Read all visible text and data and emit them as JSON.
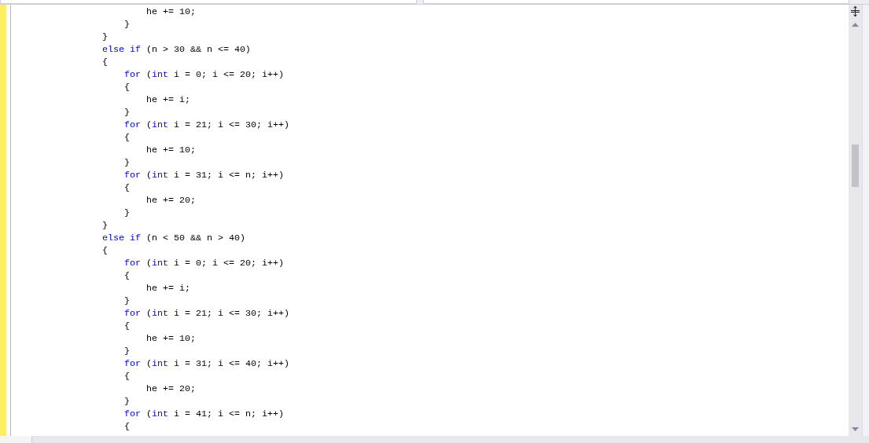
{
  "editor": {
    "lines": [
      {
        "children": [
          {
            "children": [
              {
                "tokens": [
                  {
                    "kind": "plain",
                    "text": "he += 10;"
                  }
                ]
              }
            ]
          },
          {
            "tokens": [
              {
                "kind": "plain",
                "text": "}"
              }
            ]
          }
        ]
      },
      {
        "tokens": [
          {
            "kind": "plain",
            "text": "}"
          }
        ]
      },
      {
        "tokens": [
          {
            "kind": "keyword",
            "text": "else if"
          },
          {
            "kind": "plain",
            "text": " (n > 30 && n <= 40)"
          }
        ]
      },
      {
        "tokens": [
          {
            "kind": "plain",
            "text": "{"
          }
        ],
        "children": [
          {
            "tokens": [
              {
                "kind": "keyword",
                "text": "for"
              },
              {
                "kind": "plain",
                "text": " ("
              },
              {
                "kind": "keyword",
                "text": "int"
              },
              {
                "kind": "plain",
                "text": " i = 0; i <= 20; i++)"
              }
            ]
          },
          {
            "tokens": [
              {
                "kind": "plain",
                "text": "{"
              }
            ],
            "children": [
              {
                "tokens": [
                  {
                    "kind": "plain",
                    "text": "he += i;"
                  }
                ]
              }
            ]
          },
          {
            "tokens": [
              {
                "kind": "plain",
                "text": "}"
              }
            ]
          },
          {
            "tokens": [
              {
                "kind": "keyword",
                "text": "for"
              },
              {
                "kind": "plain",
                "text": " ("
              },
              {
                "kind": "keyword",
                "text": "int"
              },
              {
                "kind": "plain",
                "text": " i = 21; i <= 30; i++)"
              }
            ]
          },
          {
            "tokens": [
              {
                "kind": "plain",
                "text": "{"
              }
            ],
            "children": [
              {
                "tokens": [
                  {
                    "kind": "plain",
                    "text": "he += 10;"
                  }
                ]
              }
            ]
          },
          {
            "tokens": [
              {
                "kind": "plain",
                "text": "}"
              }
            ]
          },
          {
            "tokens": [
              {
                "kind": "keyword",
                "text": "for"
              },
              {
                "kind": "plain",
                "text": " ("
              },
              {
                "kind": "keyword",
                "text": "int"
              },
              {
                "kind": "plain",
                "text": " i = 31; i <= n; i++)"
              }
            ]
          },
          {
            "tokens": [
              {
                "kind": "plain",
                "text": "{"
              }
            ],
            "children": [
              {
                "tokens": [
                  {
                    "kind": "plain",
                    "text": "he += 20;"
                  }
                ]
              }
            ]
          },
          {
            "tokens": [
              {
                "kind": "plain",
                "text": "}"
              }
            ]
          }
        ]
      },
      {
        "tokens": [
          {
            "kind": "plain",
            "text": "}"
          }
        ]
      },
      {
        "tokens": [
          {
            "kind": "keyword",
            "text": "else if"
          },
          {
            "kind": "plain",
            "text": " (n < 50 && n > 40)"
          }
        ]
      },
      {
        "tokens": [
          {
            "kind": "plain",
            "text": "{"
          }
        ],
        "children": [
          {
            "tokens": [
              {
                "kind": "keyword",
                "text": "for"
              },
              {
                "kind": "plain",
                "text": " ("
              },
              {
                "kind": "keyword",
                "text": "int"
              },
              {
                "kind": "plain",
                "text": " i = 0; i <= 20; i++)"
              }
            ]
          },
          {
            "tokens": [
              {
                "kind": "plain",
                "text": "{"
              }
            ],
            "children": [
              {
                "tokens": [
                  {
                    "kind": "plain",
                    "text": "he += i;"
                  }
                ]
              }
            ]
          },
          {
            "tokens": [
              {
                "kind": "plain",
                "text": "}"
              }
            ]
          },
          {
            "tokens": [
              {
                "kind": "keyword",
                "text": "for"
              },
              {
                "kind": "plain",
                "text": " ("
              },
              {
                "kind": "keyword",
                "text": "int"
              },
              {
                "kind": "plain",
                "text": " i = 21; i <= 30; i++)"
              }
            ]
          },
          {
            "tokens": [
              {
                "kind": "plain",
                "text": "{"
              }
            ],
            "children": [
              {
                "tokens": [
                  {
                    "kind": "plain",
                    "text": "he += 10;"
                  }
                ]
              }
            ]
          },
          {
            "tokens": [
              {
                "kind": "plain",
                "text": "}"
              }
            ]
          },
          {
            "tokens": [
              {
                "kind": "keyword",
                "text": "for"
              },
              {
                "kind": "plain",
                "text": " ("
              },
              {
                "kind": "keyword",
                "text": "int"
              },
              {
                "kind": "plain",
                "text": " i = 31; i <= 40; i++)"
              }
            ]
          },
          {
            "tokens": [
              {
                "kind": "plain",
                "text": "{"
              }
            ],
            "children": [
              {
                "tokens": [
                  {
                    "kind": "plain",
                    "text": "he += 20;"
                  }
                ]
              }
            ]
          },
          {
            "tokens": [
              {
                "kind": "plain",
                "text": "}"
              }
            ]
          },
          {
            "tokens": [
              {
                "kind": "keyword",
                "text": "for"
              },
              {
                "kind": "plain",
                "text": " ("
              },
              {
                "kind": "keyword",
                "text": "int"
              },
              {
                "kind": "plain",
                "text": " i = 41; i <= n; i++)"
              }
            ]
          },
          {
            "tokens": [
              {
                "kind": "plain",
                "text": "{"
              }
            ]
          }
        ]
      }
    ]
  }
}
